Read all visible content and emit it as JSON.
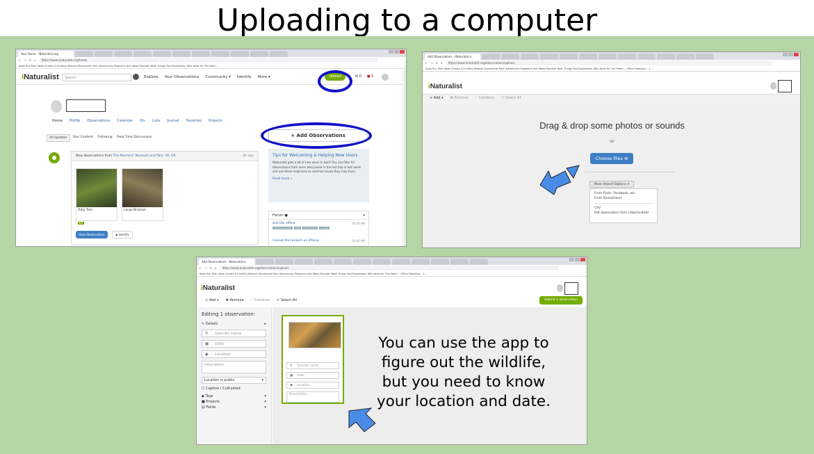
{
  "slide_title": "Uploading to a computer",
  "caption_lines": [
    "You can use the app to",
    "figure out the wildlife,",
    "but you need to know",
    "your location and date."
  ],
  "colors": {
    "background": "#b5d6a4",
    "inat_green": "#74ac00",
    "button_blue": "#3d7fc4",
    "highlight_circle": "#1212c8",
    "arrow_blue": "#4a8be8"
  },
  "shot1": {
    "tab_title": "Your Home · iNaturalist.org",
    "url": "https://www.inaturalist.org/home",
    "bookmarks": "Apps   Eco Park Ideas   Grants & Funding   Natural Discoveries   Park Adventures   Programs and Ideas   Random Neat Things   Sea Exploration   IDEs   Atlas for The Warr...",
    "brand_prefix": "i",
    "brand_rest": "Naturalist",
    "search_placeholder": "Search",
    "nav": [
      "Explore",
      "Your Observations",
      "Community ▾",
      "Identify",
      "More ▾"
    ],
    "upload_label": "Upload",
    "count_a": "0",
    "count_b": "5",
    "profile_tabs": [
      "Home",
      "Profile",
      "Observations",
      "Calendar",
      "IDs",
      "Lists",
      "Journal",
      "Favorites",
      "Projects"
    ],
    "add_observations": "Add Observations",
    "subtabs": [
      "All Updates",
      "Your Content",
      "Following",
      "Real Time Discussions"
    ],
    "feed_header_prefix": "New observations from ",
    "feed_header_link": "The Mariners' Museum and Park, VA, US",
    "feed_time": "8h ago",
    "obs": [
      {
        "name": "Tulip Tree",
        "badge": "RG"
      },
      {
        "name": "Large Bracket",
        "badge": ""
      }
    ],
    "view_observations": "View Observations",
    "identify": "Identify",
    "tips_title": "Tips for Welcoming & Helping New Users",
    "tips_body": "iNaturalist gets a lot of new users in April! You can filter for observations from users who joined in the last day or last week and use these responses to common issues they may have.",
    "read_more": "Read more »",
    "forum_label": "Forum",
    "forum_items": [
      {
        "title": "Add IDs offline",
        "time": "10:50 AM",
        "tags": [
          "feature-requests",
          "web",
          "android-app",
          "ios-app"
        ]
      },
      {
        "title": "Cannot find project on iPhone",
        "time": "10:45 AM",
        "tags": []
      }
    ]
  },
  "shot2": {
    "tab_title": "Add Observations · iNaturalist.o",
    "url": "https://www.inaturalist.org/observations/upload",
    "bookmarks": "Apps   Eco Park Ideas   Grants & Funding   Natural Discoveries   Park Adventures   Programs and Ideas   Random Neat Things   Sea Exploration   IDEs   Atlas for The Marin...   Office Directory - 1...",
    "brand_prefix": "i",
    "brand_rest": "Naturalist",
    "toolbar": [
      "+ Add ▾",
      "✖ Remove",
      "⟋ Combine",
      "☐ Select All"
    ],
    "drop_text": "Drag & drop some photos or sounds",
    "or_text": "or",
    "choose_files": "Choose files",
    "more_import": "More Import Options ▾",
    "menu": [
      "From Flickr, Facebook, etc.",
      "From Soundcloud",
      "CSV",
      "Old observation form (deprecated)"
    ]
  },
  "shot3": {
    "tab_title": "Add Observations · iNaturalist.o",
    "url": "https://www.inaturalist.org/observations/upload",
    "bookmarks": "Apps   Eco Park Ideas   Grants & Funding   Natural Discoveries   Park Adventures   Programs and Ideas   Random Neat Things   Sea Exploration   IDEs   Atlas for The Marin...   Office Directory - 1...",
    "brand_prefix": "i",
    "brand_rest": "Naturalist",
    "toolbar": [
      "+ Add ▾",
      "✖ Remove",
      "⟋ Combine",
      "✔ Select All"
    ],
    "submit": "Submit 1 observation",
    "editing": "Editing 1 observation:",
    "details": "Details",
    "species_placeholder": "Species name",
    "date_placeholder": "Date",
    "location_placeholder": "Location",
    "description_placeholder": "Description",
    "location_public": "Location is public",
    "captive": "Captive / Cultivated",
    "tags": "Tags",
    "projects": "Projects",
    "fields": "Fields",
    "card_species": "Species name",
    "card_date": "Date",
    "card_location": "Location",
    "card_description": "Description"
  }
}
